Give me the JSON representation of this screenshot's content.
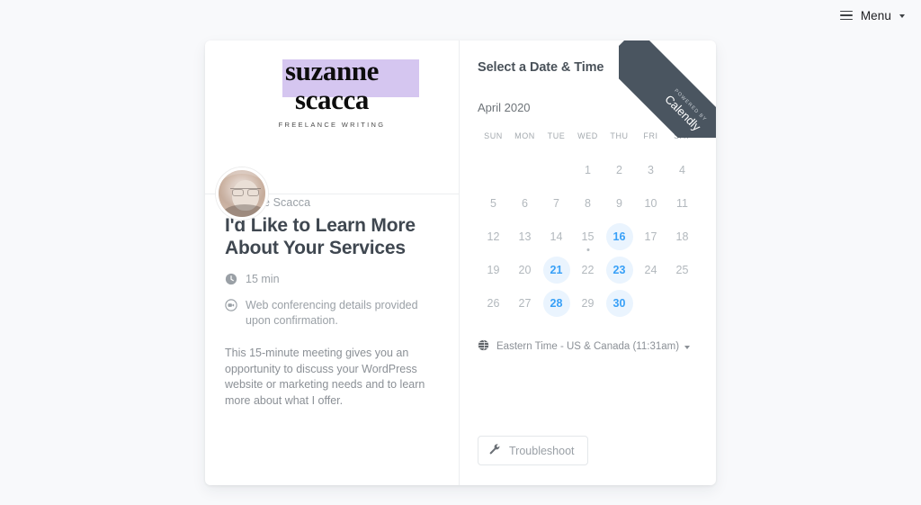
{
  "topbar": {
    "menu_label": "Menu",
    "hamburger_icon": "hamburger-icon",
    "caret_icon": "chevron-down-icon"
  },
  "brand": {
    "logo_line1": "suzanne",
    "logo_line2": "scacca",
    "logo_tagline": "FREELANCE WRITING",
    "highlight_color": "#d5c6f0"
  },
  "event": {
    "host_name": "Suzanne Scacca",
    "title": "I'd Like to Learn More About Your Services",
    "duration": "15 min",
    "duration_icon": "clock-icon",
    "location": "Web conferencing details provided upon confirmation.",
    "location_icon": "video-camera-icon",
    "description": "This 15-minute meeting gives you an opportunity to discuss your WordPress website or marketing needs and to learn more about what I offer."
  },
  "calendar": {
    "heading": "Select a Date & Time",
    "month_label": "April 2020",
    "prev_label": "‹",
    "next_label": "›",
    "prev_icon": "chevron-left-icon",
    "next_icon": "chevron-right-icon",
    "accent_color": "#38a0f7",
    "available_bg": "#eaf4fe",
    "day_names": [
      "SUN",
      "MON",
      "TUE",
      "WED",
      "THU",
      "FRI",
      "SAT"
    ],
    "leading_blanks": 3,
    "days": [
      {
        "n": "1",
        "state": "disabled"
      },
      {
        "n": "2",
        "state": "disabled"
      },
      {
        "n": "3",
        "state": "disabled"
      },
      {
        "n": "4",
        "state": "disabled"
      },
      {
        "n": "5",
        "state": "disabled"
      },
      {
        "n": "6",
        "state": "disabled"
      },
      {
        "n": "7",
        "state": "disabled"
      },
      {
        "n": "8",
        "state": "disabled"
      },
      {
        "n": "9",
        "state": "disabled"
      },
      {
        "n": "10",
        "state": "disabled"
      },
      {
        "n": "11",
        "state": "disabled"
      },
      {
        "n": "12",
        "state": "disabled"
      },
      {
        "n": "13",
        "state": "disabled"
      },
      {
        "n": "14",
        "state": "disabled"
      },
      {
        "n": "15",
        "state": "today"
      },
      {
        "n": "16",
        "state": "available"
      },
      {
        "n": "17",
        "state": "disabled"
      },
      {
        "n": "18",
        "state": "disabled"
      },
      {
        "n": "19",
        "state": "disabled"
      },
      {
        "n": "20",
        "state": "disabled"
      },
      {
        "n": "21",
        "state": "available"
      },
      {
        "n": "22",
        "state": "disabled"
      },
      {
        "n": "23",
        "state": "available"
      },
      {
        "n": "24",
        "state": "disabled"
      },
      {
        "n": "25",
        "state": "disabled"
      },
      {
        "n": "26",
        "state": "disabled"
      },
      {
        "n": "27",
        "state": "disabled"
      },
      {
        "n": "28",
        "state": "available"
      },
      {
        "n": "29",
        "state": "disabled"
      },
      {
        "n": "30",
        "state": "available"
      }
    ],
    "timezone": "Eastern Time - US & Canada (11:31am)",
    "timezone_icon": "globe-icon",
    "troubleshoot_label": "Troubleshoot",
    "troubleshoot_icon": "wrench-icon"
  },
  "ribbon": {
    "powered_by": "POWERED BY",
    "brand": "Calendly",
    "color": "#4a5560"
  }
}
